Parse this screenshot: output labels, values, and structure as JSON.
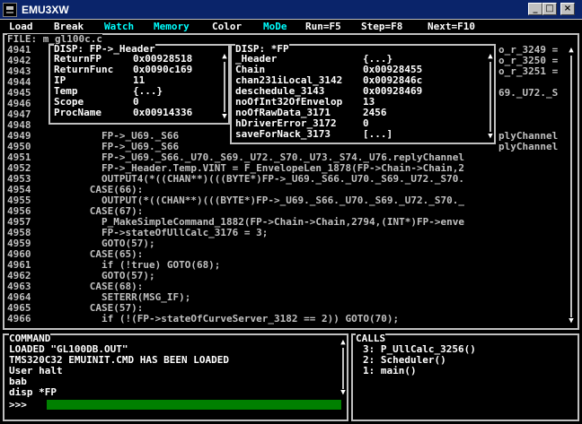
{
  "window": {
    "title": "EMU3XW"
  },
  "menu": [
    {
      "label": "Load"
    },
    {
      "label": "Break"
    },
    {
      "label": "Watch"
    },
    {
      "label": "Memory"
    },
    {
      "label": "Color"
    },
    {
      "label": "MoDe"
    },
    {
      "label": "Run=F5"
    },
    {
      "label": "Step=F8"
    },
    {
      "label": "Next=F10"
    }
  ],
  "source": {
    "file_label": "FILE: m_gl100c.c",
    "lines": [
      {
        "n": "4941",
        "t": ""
      },
      {
        "n": "4942",
        "t": ""
      },
      {
        "n": "4943",
        "t": ""
      },
      {
        "n": "4944",
        "t": ""
      },
      {
        "n": "4945",
        "t": ""
      },
      {
        "n": "4946",
        "t": ""
      },
      {
        "n": "4947",
        "t": ""
      },
      {
        "n": "4948",
        "t": ""
      },
      {
        "n": "4949",
        "t": "        FP->_U69._S66"
      },
      {
        "n": "4950",
        "t": "        FP->_U69._S66"
      },
      {
        "n": "4951",
        "t": "        FP->_U69._S66._U70._S69._U72._S70._U73._S74._U76.replyChannel"
      },
      {
        "n": "4952",
        "t": "        FP->_Header.Temp.VINT = F_EnvelopeLen_1878(FP->Chain->Chain,2"
      },
      {
        "n": "4953",
        "t": "        OUTPUT4(*((CHAN**)(((BYTE*)FP->_U69._S66._U70._S69._U72._S70."
      },
      {
        "n": "4954",
        "t": "      CASE(66):"
      },
      {
        "n": "4955",
        "t": "        OUTPUT(*((CHAN**)(((BYTE*)FP->_U69._S66._U70._S69._U72._S70._"
      },
      {
        "n": "4956",
        "t": "      CASE(67):"
      },
      {
        "n": "4957",
        "t": "        P_MakeSimpleCommand_1882(FP->Chain->Chain,2794,(INT*)FP->enve"
      },
      {
        "n": "4958",
        "t": "        FP->stateOfUllCalc_3176 = 3;"
      },
      {
        "n": "4959",
        "t": "        GOTO(57);"
      },
      {
        "n": "4960",
        "t": "      CASE(65):"
      },
      {
        "n": "4961",
        "t": "        if (!true) GOTO(68);"
      },
      {
        "n": "4962",
        "t": "        GOTO(57);"
      },
      {
        "n": "4963",
        "t": "      CASE(68):"
      },
      {
        "n": "4964",
        "t": "        SETERR(MSG_IF);"
      },
      {
        "n": "4965",
        "t": "      CASE(57):"
      },
      {
        "n": "4966",
        "t": "        if (!(FP->stateOfCurveServer_3182 == 2)) GOTO(70);"
      }
    ],
    "right_fragments": [
      {
        "row": 0,
        "t": "o_r_3249 ="
      },
      {
        "row": 1,
        "t": "o_r_3250 ="
      },
      {
        "row": 2,
        "t": "o_r_3251 ="
      },
      {
        "row": 4,
        "t": "69._U72._S"
      },
      {
        "row": 8,
        "t": "plyChannel"
      },
      {
        "row": 9,
        "t": "plyChannel"
      }
    ]
  },
  "header_popup": {
    "title": "DISP: FP->_Header",
    "rows": [
      {
        "k": "ReturnFP",
        "v": "0x00928518"
      },
      {
        "k": "ReturnFunc",
        "v": "0x0090c169"
      },
      {
        "k": "IP",
        "v": "11"
      },
      {
        "k": "Temp",
        "v": "{...}"
      },
      {
        "k": "Scope",
        "v": "0"
      },
      {
        "k": "ProcName",
        "v": "0x00914336"
      }
    ]
  },
  "fp_popup": {
    "title": "DISP: *FP",
    "rows": [
      {
        "k": "_Header",
        "v": "{...}"
      },
      {
        "k": "Chain",
        "v": "0x00928455"
      },
      {
        "k": "chan231iLocal_3142",
        "v": "0x0092846c"
      },
      {
        "k": "deschedule_3143",
        "v": "0x00928469"
      },
      {
        "k": "noOfInt32OfEnvelop",
        "v": "13"
      },
      {
        "k": "noOfRawData_3171",
        "v": "2456"
      },
      {
        "k": "hDriverError_3172",
        "v": "0"
      },
      {
        "k": "saveForNack_3173",
        "v": "[...]"
      }
    ]
  },
  "command": {
    "title": "COMMAND",
    "lines": [
      "LOADED \"GL100DB.OUT\"",
      "TMS320C32 EMUINIT.CMD HAS BEEN LOADED",
      "User halt",
      "bab",
      "disp *FP"
    ],
    "prompt": ">>>",
    "input_value": ""
  },
  "calls": {
    "title": "CALLS",
    "items": [
      {
        "n": "3:",
        "name": "P_UllCalc_3256()"
      },
      {
        "n": "2:",
        "name": "Scheduler()"
      },
      {
        "n": "1:",
        "name": "main()"
      }
    ]
  },
  "colors": {
    "menu_hotkey_a": "#00ffff",
    "menu_hotkey_b": "#ffffff",
    "text": "#c0c0c0",
    "input": "#008000"
  }
}
